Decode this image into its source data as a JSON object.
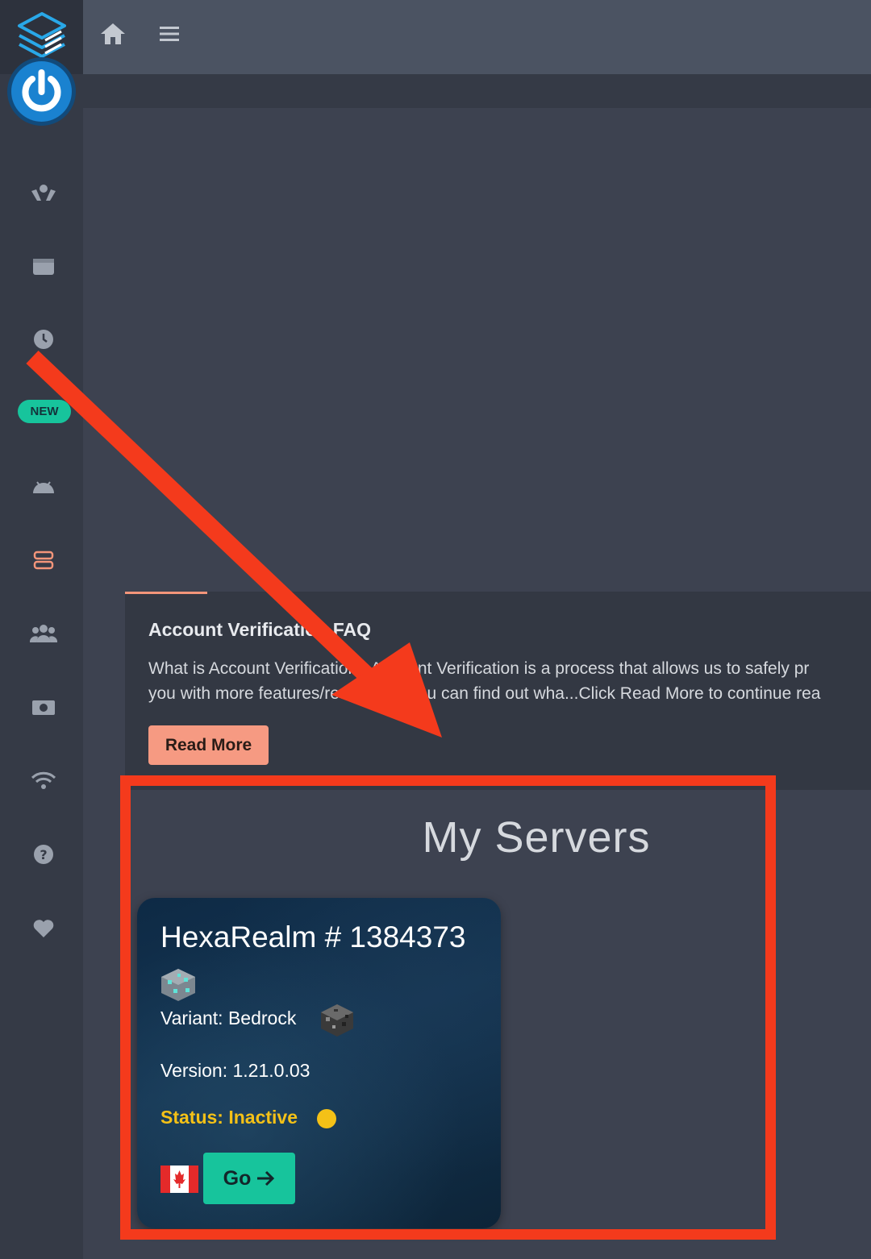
{
  "sidebar": {
    "new_badge": "NEW",
    "icons": [
      "hands-coin-icon",
      "wallet-icon",
      "clock-icon",
      "android-icon",
      "server-icon",
      "users-icon",
      "money-icon",
      "wifi-icon",
      "help-icon",
      "heart-icon"
    ]
  },
  "topbar": {
    "icons": [
      "home-icon",
      "menu-icon"
    ]
  },
  "faq": {
    "title": "Account Verification FAQ",
    "text_line1": "What is Account Verification? Account Verification is a process that allows us to safely pr",
    "text_line2": "you with more features/resources. You can find out wha...Click Read More to continue rea",
    "read_more_label": "Read More"
  },
  "servers": {
    "title": "My Servers",
    "cards": [
      {
        "name": "HexaRealm # 1384373",
        "variant": "Variant: Bedrock",
        "version": "Version: 1.21.0.03",
        "status": "Status: Inactive",
        "go_label": "Go",
        "flag": "canada-flag-icon"
      }
    ]
  },
  "colors": {
    "accent_green": "#17c49c",
    "accent_salmon": "#f69a82",
    "status_yellow": "#f4c117",
    "annotation_red": "#f43a1c"
  }
}
